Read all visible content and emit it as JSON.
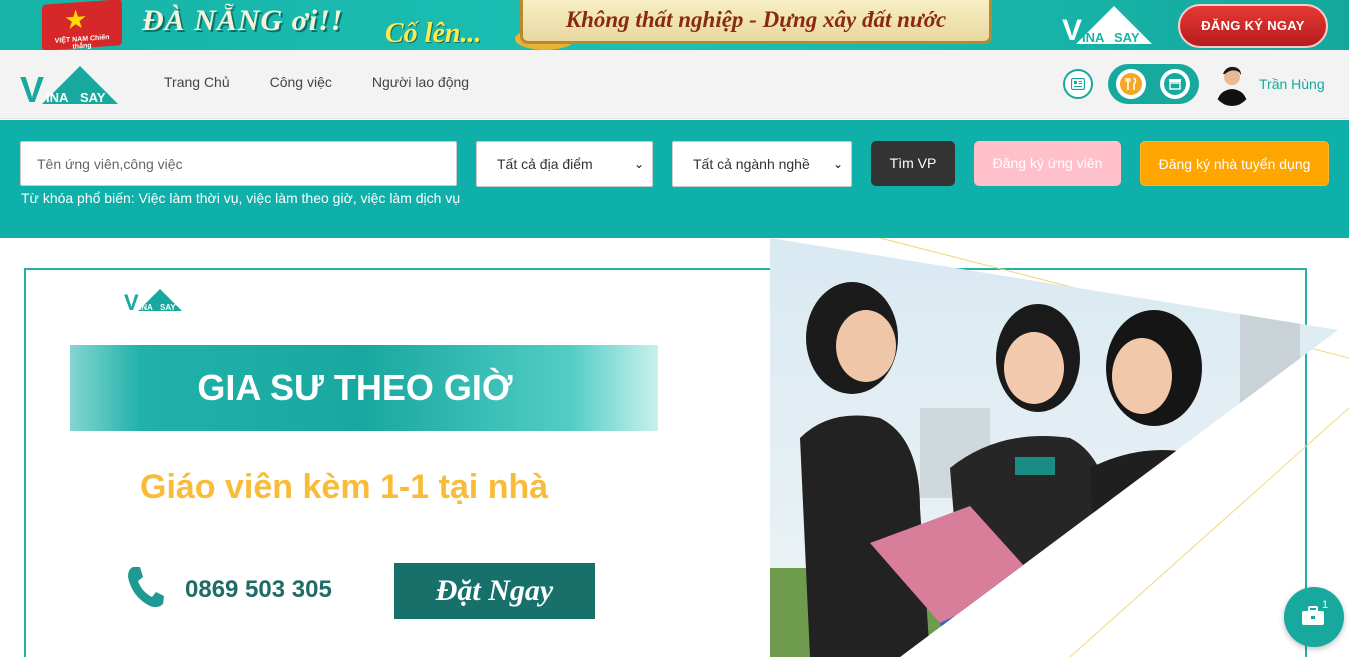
{
  "promo": {
    "flag_text": "VIỆT NAM Chiến thắng",
    "headline": "ĐÀ NẴNG ơi!!",
    "cheer": "Cố lên...",
    "slogan": "Không thất nghiệp - Dựng xây đất nước",
    "cta": "ĐĂNG KÝ NGAY"
  },
  "nav": {
    "items": [
      "Trang Chủ",
      "Công việc",
      "Người lao động"
    ],
    "user_name": "Trần Hùng"
  },
  "search": {
    "placeholder": "Tên ứng viên,công việc",
    "location": "Tất cả địa điểm",
    "category": "Tất cả ngành nghề",
    "find_button": "Tìm VP",
    "candidate_button": "Đăng ký ứng viên",
    "employer_button": "Đăng ký nhà tuyển dụng",
    "keywords": "Từ khóa phổ biến: Việc làm thời vụ, việc làm theo giờ, việc làm dịch vụ"
  },
  "hero": {
    "title": "GIA SƯ THEO GIỜ",
    "subtitle": "Giáo viên kèm 1-1 tại nhà",
    "phone": "0869 503 305",
    "book_button": "Đặt Ngay"
  },
  "fab": {
    "badge": "1"
  },
  "colors": {
    "brand_teal": "#0fb0aa",
    "accent_orange": "#ffa500",
    "accent_pink": "#ffc0cb",
    "hero_yellow": "#f8bc3a"
  },
  "icons": [
    "newspaper-icon",
    "food-icon",
    "store-icon",
    "phone-icon",
    "briefcase-icon",
    "chevron-down-icon"
  ]
}
